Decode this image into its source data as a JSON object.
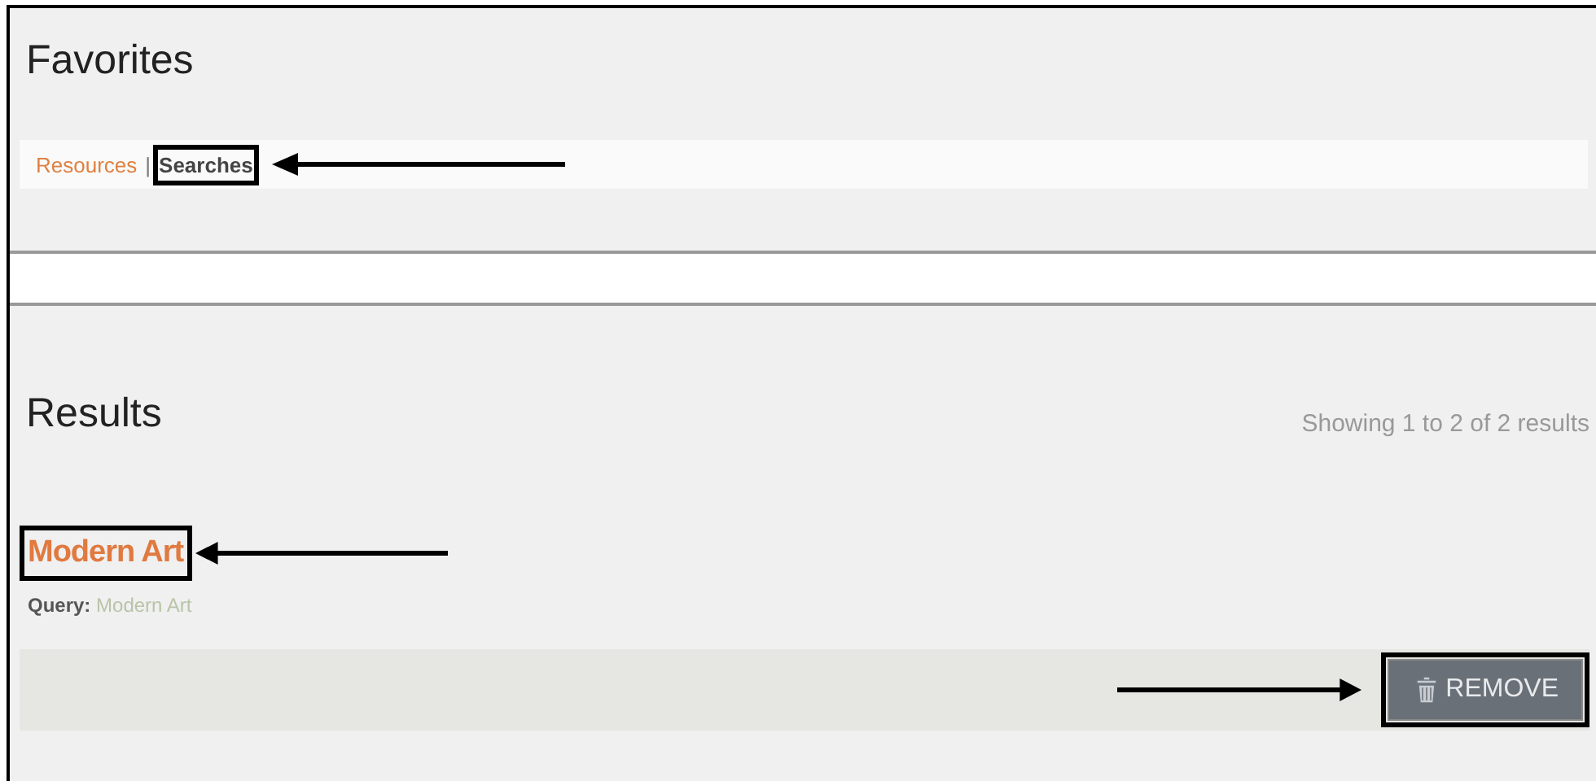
{
  "page_title": "Favorites",
  "tab_separator": "|",
  "tabs": [
    {
      "label": "Resources",
      "selected": false,
      "boxed": false
    },
    {
      "label": "Searches",
      "selected": true,
      "boxed": true,
      "arrow": true
    }
  ],
  "results": {
    "title": "Results",
    "summary": "Showing 1 to 2 of 2 results",
    "items": [
      {
        "title": "Modern Art",
        "boxed": true,
        "arrow": true,
        "query_label": "Query:",
        "query": "Modern Art",
        "action": {
          "label": "REMOVE",
          "boxed": true,
          "arrow": true
        }
      }
    ]
  }
}
